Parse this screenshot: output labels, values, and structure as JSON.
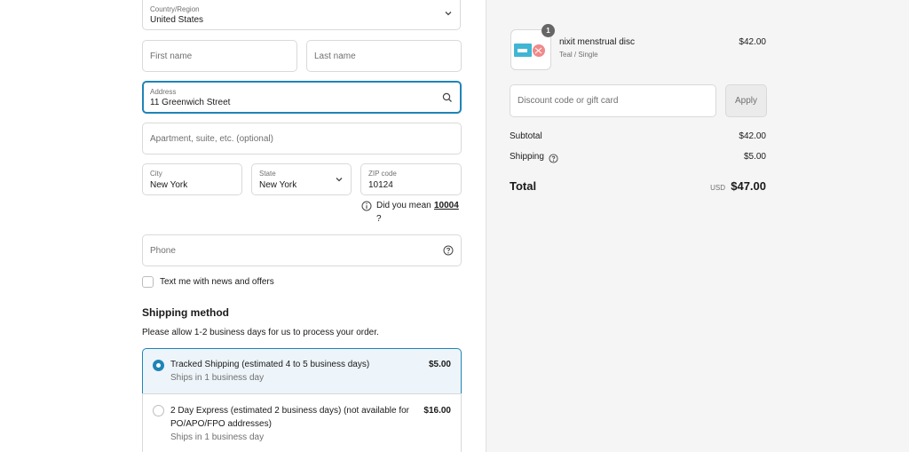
{
  "form": {
    "country": {
      "label": "Country/Region",
      "value": "United States"
    },
    "first_name_placeholder": "First name",
    "last_name_placeholder": "Last name",
    "address": {
      "label": "Address",
      "value": "11 Greenwich Street"
    },
    "apartment_placeholder": "Apartment, suite, etc. (optional)",
    "city": {
      "label": "City",
      "value": "New York"
    },
    "state": {
      "label": "State",
      "value": "New York"
    },
    "zip": {
      "label": "ZIP code",
      "value": "10124"
    },
    "zip_suggestion": {
      "prefix": "Did you mean",
      "suggested": "10004",
      "suffix": "?"
    },
    "phone_placeholder": "Phone",
    "text_me_label": "Text me with news and offers"
  },
  "shipping": {
    "title": "Shipping method",
    "note": "Please allow 1-2 business days for us to process your order.",
    "options": [
      {
        "name": "Tracked Shipping (estimated 4 to 5 business days)",
        "sub": "Ships in 1 business day",
        "price": "$5.00"
      },
      {
        "name_line1": "2 Day Express (estimated 2 business days) (not available for",
        "name_line2": "PO/APO/FPO addresses)",
        "sub": "Ships in 1 business day",
        "price": "$16.00"
      }
    ]
  },
  "summary": {
    "item": {
      "quantity": "1",
      "name": "nixit menstrual disc",
      "variant": "Teal / Single",
      "price": "$42.00"
    },
    "discount_placeholder": "Discount code or gift card",
    "apply_label": "Apply",
    "subtotal_label": "Subtotal",
    "subtotal_value": "$42.00",
    "shipping_label": "Shipping",
    "shipping_value": "$5.00",
    "total_label": "Total",
    "currency": "USD",
    "total_value": "$47.00"
  }
}
